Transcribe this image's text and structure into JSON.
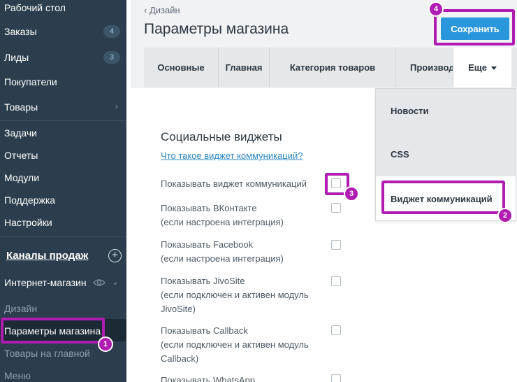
{
  "colors": {
    "sidebar_bg": "#2c3e4d",
    "accent": "#2a97dd",
    "annotation": "#b01bb1",
    "link": "#2a86c4"
  },
  "sidebar": {
    "items": [
      {
        "label": "Рабочий стол"
      },
      {
        "label": "Заказы",
        "badge": "4"
      },
      {
        "label": "Лиды",
        "badge": "3"
      },
      {
        "label": "Покупатели"
      },
      {
        "label": "Товары",
        "chevron": "›"
      },
      {
        "label": "Задачи"
      },
      {
        "label": "Отчеты"
      },
      {
        "label": "Модули"
      },
      {
        "label": "Поддержка"
      },
      {
        "label": "Настройки"
      }
    ],
    "channels_title": "Каналы продаж",
    "channels_add_icon": "plus-circle-icon",
    "shop": {
      "label": "Интернет-магазин",
      "icon": "eye-icon",
      "chevron": "⌄"
    },
    "sub_items": [
      {
        "label": "Дизайн"
      },
      {
        "label": "Параметры магазина",
        "active": true
      },
      {
        "label": "Товары на главной"
      },
      {
        "label": "Меню"
      }
    ]
  },
  "header": {
    "breadcrumb_back": "‹",
    "breadcrumb": "Дизайн",
    "title": "Параметры магазина",
    "save_label": "Сохранить"
  },
  "tabs": [
    {
      "label": "Основные"
    },
    {
      "label": "Главная"
    },
    {
      "label": "Категория товаров"
    },
    {
      "label": "Производ"
    },
    {
      "label": "Еще",
      "dropdown": true
    }
  ],
  "dropdown": {
    "items": [
      {
        "label": "Новости"
      },
      {
        "label": "CSS"
      },
      {
        "label": "Виджет коммуникаций"
      }
    ]
  },
  "section": {
    "title": "Социальные виджеты",
    "help_link": "Что такое виджет коммуникаций?",
    "options": [
      {
        "lines": [
          "Показывать виджет коммуникаций"
        ],
        "checked": false
      },
      {
        "lines": [
          "Показывать ВКонтакте",
          "(если настроена интеграция)"
        ],
        "checked": false
      },
      {
        "lines": [
          "Показывать Facebook",
          "(если настроена интеграция)"
        ],
        "checked": false
      },
      {
        "lines": [
          "Показывать JivoSite",
          "(если подключен и активен модуль",
          "JivoSite)"
        ],
        "checked": false
      },
      {
        "lines": [
          "Показывать Callback",
          "(если подключен и активен модуль",
          "Callback)"
        ],
        "checked": false
      },
      {
        "lines": [
          "Показывать WhatsApp"
        ],
        "checked": false
      }
    ]
  },
  "annotations": [
    {
      "number": "1",
      "target": "Параметры магазина"
    },
    {
      "number": "2",
      "target": "Виджет коммуникаций"
    },
    {
      "number": "3",
      "target": "Показывать виджет коммуникаций"
    },
    {
      "number": "4",
      "target": "Сохранить"
    }
  ]
}
